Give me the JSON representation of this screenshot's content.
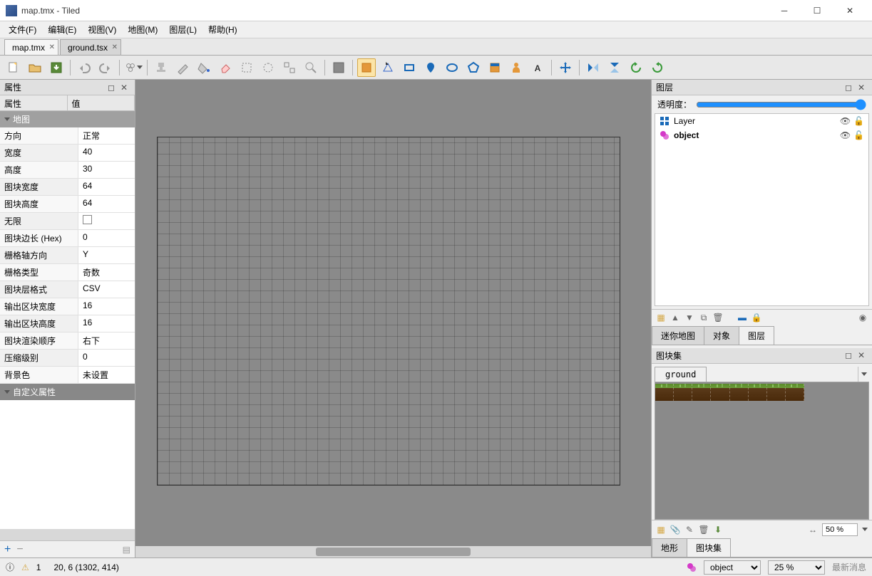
{
  "title": "map.tmx - Tiled",
  "menu": {
    "file": "文件(F)",
    "edit": "编辑(E)",
    "view": "视图(V)",
    "map": "地图(M)",
    "layer": "图层(L)",
    "help": "帮助(H)"
  },
  "tabs": [
    {
      "label": "map.tmx",
      "active": true
    },
    {
      "label": "ground.tsx",
      "active": false
    }
  ],
  "panels": {
    "properties_title": "属性",
    "prop_header_key": "属性",
    "prop_header_val": "值",
    "group_map": "地图",
    "group_custom": "自定义属性",
    "rows": [
      {
        "k": "方向",
        "v": "正常"
      },
      {
        "k": "宽度",
        "v": "40"
      },
      {
        "k": "高度",
        "v": "30"
      },
      {
        "k": "图块宽度",
        "v": "64"
      },
      {
        "k": "图块高度",
        "v": "64"
      },
      {
        "k": "无限",
        "v": "checkbox"
      },
      {
        "k": "图块边长 (Hex)",
        "v": "0"
      },
      {
        "k": "栅格轴方向",
        "v": "Y"
      },
      {
        "k": "栅格类型",
        "v": "奇数"
      },
      {
        "k": "图块层格式",
        "v": "CSV"
      },
      {
        "k": "输出区块宽度",
        "v": "16"
      },
      {
        "k": "输出区块高度",
        "v": "16"
      },
      {
        "k": "图块渲染顺序",
        "v": "右下"
      },
      {
        "k": "压缩级别",
        "v": "0"
      },
      {
        "k": "背景色",
        "v": "未设置"
      }
    ]
  },
  "layers_panel": {
    "title": "图层",
    "opacity_label": "透明度：",
    "layers": [
      {
        "name": "Layer",
        "type": "tile",
        "selected": false
      },
      {
        "name": "object",
        "type": "object",
        "selected": true
      }
    ],
    "tabs": [
      "迷你地图",
      "对象",
      "图层"
    ],
    "active_tab": "图层"
  },
  "tileset_panel": {
    "title": "图块集",
    "tileset_name": "ground",
    "tabs": [
      "地形",
      "图块集"
    ],
    "active_tab": "图块集",
    "zoom": "50 %"
  },
  "statusbar": {
    "warnings": "1",
    "coords": "20, 6 (1302, 414)",
    "layer_select": "object",
    "zoom": "25 %",
    "latest": "最新消息"
  }
}
